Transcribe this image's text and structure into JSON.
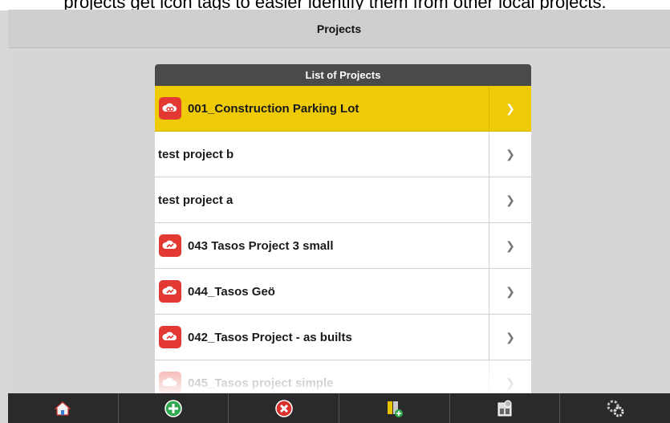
{
  "caption": "projects get icon tags to easier identify them from other local projects.",
  "header": {
    "title": "Projects"
  },
  "list": {
    "title": "List of Projects",
    "items": [
      {
        "label": "001_Construction Parking Lot",
        "icon": "cloud-link-icon",
        "selected": true
      },
      {
        "label": "test project b",
        "icon": "",
        "selected": false
      },
      {
        "label": "test project a",
        "icon": "",
        "selected": false
      },
      {
        "label": "043 Tasos Project 3 small",
        "icon": "cloud-sync-icon",
        "selected": false
      },
      {
        "label": "044_Tasos Geö",
        "icon": "cloud-sync-icon",
        "selected": false
      },
      {
        "label": "042_Tasos Project - as builts",
        "icon": "cloud-sync-icon",
        "selected": false
      },
      {
        "label": "045_Tasos project simple",
        "icon": "cloud-sync-icon",
        "selected": false
      }
    ],
    "chevron": "❯"
  },
  "toolbar": {
    "buttons": [
      "home-icon",
      "add-icon",
      "delete-icon",
      "add-folder-icon",
      "project-settings-icon",
      "settings-gears-icon"
    ]
  },
  "colors": {
    "selected": "#eecb06",
    "header": "#4a4a4a",
    "cloud_icon": "#e23a32",
    "bottom_bar": "#2a2a2a"
  }
}
